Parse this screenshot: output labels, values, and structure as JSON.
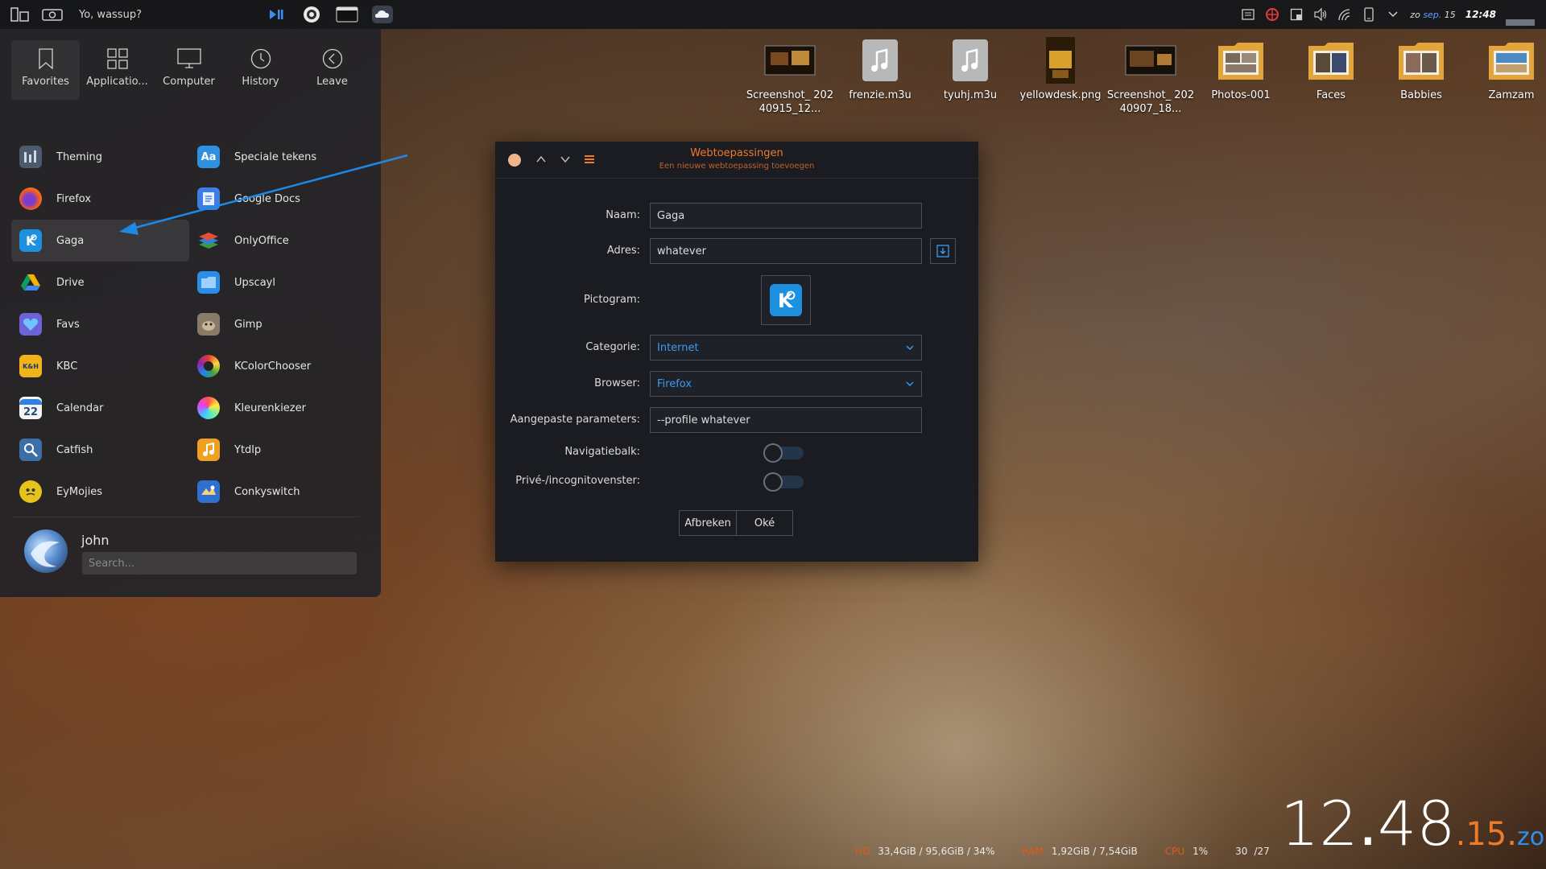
{
  "top_panel": {
    "greeting": "Yo, wassup?",
    "date_day": "zo",
    "date_month": "sep.",
    "date_num": "15",
    "time": "12:48"
  },
  "launcher": {
    "tabs": [
      {
        "label": "Favorites",
        "icon": "bookmark-icon"
      },
      {
        "label": "Applicatio...",
        "icon": "grid-icon"
      },
      {
        "label": "Computer",
        "icon": "monitor-icon"
      },
      {
        "label": "History",
        "icon": "clock-icon"
      },
      {
        "label": "Leave",
        "icon": "chevron-left-icon"
      }
    ],
    "apps_left": [
      {
        "label": "Theming",
        "color": "#4d5a6e"
      },
      {
        "label": "Firefox",
        "color": "#e25c1e"
      },
      {
        "label": "Gaga",
        "color": "#1e90e0"
      },
      {
        "label": "Drive",
        "color": "#2f8f3a"
      },
      {
        "label": "Favs",
        "color": "#6e63d6"
      },
      {
        "label": "KBC",
        "color": "#f2b21a"
      },
      {
        "label": "Calendar",
        "color": "#f4f4f4"
      },
      {
        "label": "Catfish",
        "color": "#3b6fa8"
      },
      {
        "label": "EyMojies",
        "color": "#e6c21a"
      }
    ],
    "apps_right": [
      {
        "label": "Speciale tekens",
        "color": "#2f90e0"
      },
      {
        "label": "Google Docs",
        "color": "#3a7ee6"
      },
      {
        "label": "OnlyOffice",
        "color": "#d9533a"
      },
      {
        "label": "Upscayl",
        "color": "#2a8ee8"
      },
      {
        "label": "Gimp",
        "color": "#8a7a68"
      },
      {
        "label": "KColorChooser",
        "color": "#303030"
      },
      {
        "label": "Kleurenkiezer",
        "color": "#d84a9a"
      },
      {
        "label": "Ytdlp",
        "color": "#f0a020"
      },
      {
        "label": "Conkyswitch",
        "color": "#2f6fd0"
      }
    ],
    "selected_app": "Gaga",
    "user_name": "john",
    "search_placeholder": "Search..."
  },
  "desktop_icons": [
    {
      "label": "Screenshot_ 20240915_12...",
      "kind": "image"
    },
    {
      "label": "frenzie.m3u",
      "kind": "audio"
    },
    {
      "label": "tyuhj.m3u",
      "kind": "audio"
    },
    {
      "label": "yellowdesk.png",
      "kind": "image"
    },
    {
      "label": "Screenshot_ 20240907_18...",
      "kind": "image"
    },
    {
      "label": "Photos-001",
      "kind": "folder"
    },
    {
      "label": "Faces",
      "kind": "folder"
    },
    {
      "label": "Babbies",
      "kind": "folder"
    },
    {
      "label": "Zamzam",
      "kind": "folder"
    }
  ],
  "dialog": {
    "title": "Webtoepassingen",
    "subtitle": "Een nieuwe webtoepassing toevoegen",
    "labels": {
      "naam": "Naam:",
      "adres": "Adres:",
      "pictogram": "Pictogram:",
      "categorie": "Categorie:",
      "browser": "Browser:",
      "params": "Aangepaste parameters:",
      "navbar": "Navigatiebalk:",
      "private": "Privé-/incognitovenster:"
    },
    "values": {
      "naam": "Gaga",
      "adres": "whatever",
      "categorie": "Internet",
      "browser": "Firefox",
      "params": "--profile whatever",
      "navbar_on": false,
      "private_on": false
    },
    "buttons": {
      "cancel": "Afbreken",
      "ok": "Oké"
    }
  },
  "conky": {
    "disk_key": "HD",
    "disk_val": "33,4GiB / 95,6GiB / 34%",
    "ram_key": "RAM",
    "ram_val": "1,92GiB / 7,54GiB",
    "cpu_key": "CPU",
    "cpu_val": "1%",
    "temp_a": "30",
    "temp_b": "/27",
    "clock_h": "12",
    "clock_m": "48",
    "clock_s": "15",
    "clock_d": "zo"
  },
  "colors": {
    "accent_orange": "#f07a2a",
    "accent_blue": "#3d9af0",
    "annotation_arrow": "#1e88e5"
  }
}
